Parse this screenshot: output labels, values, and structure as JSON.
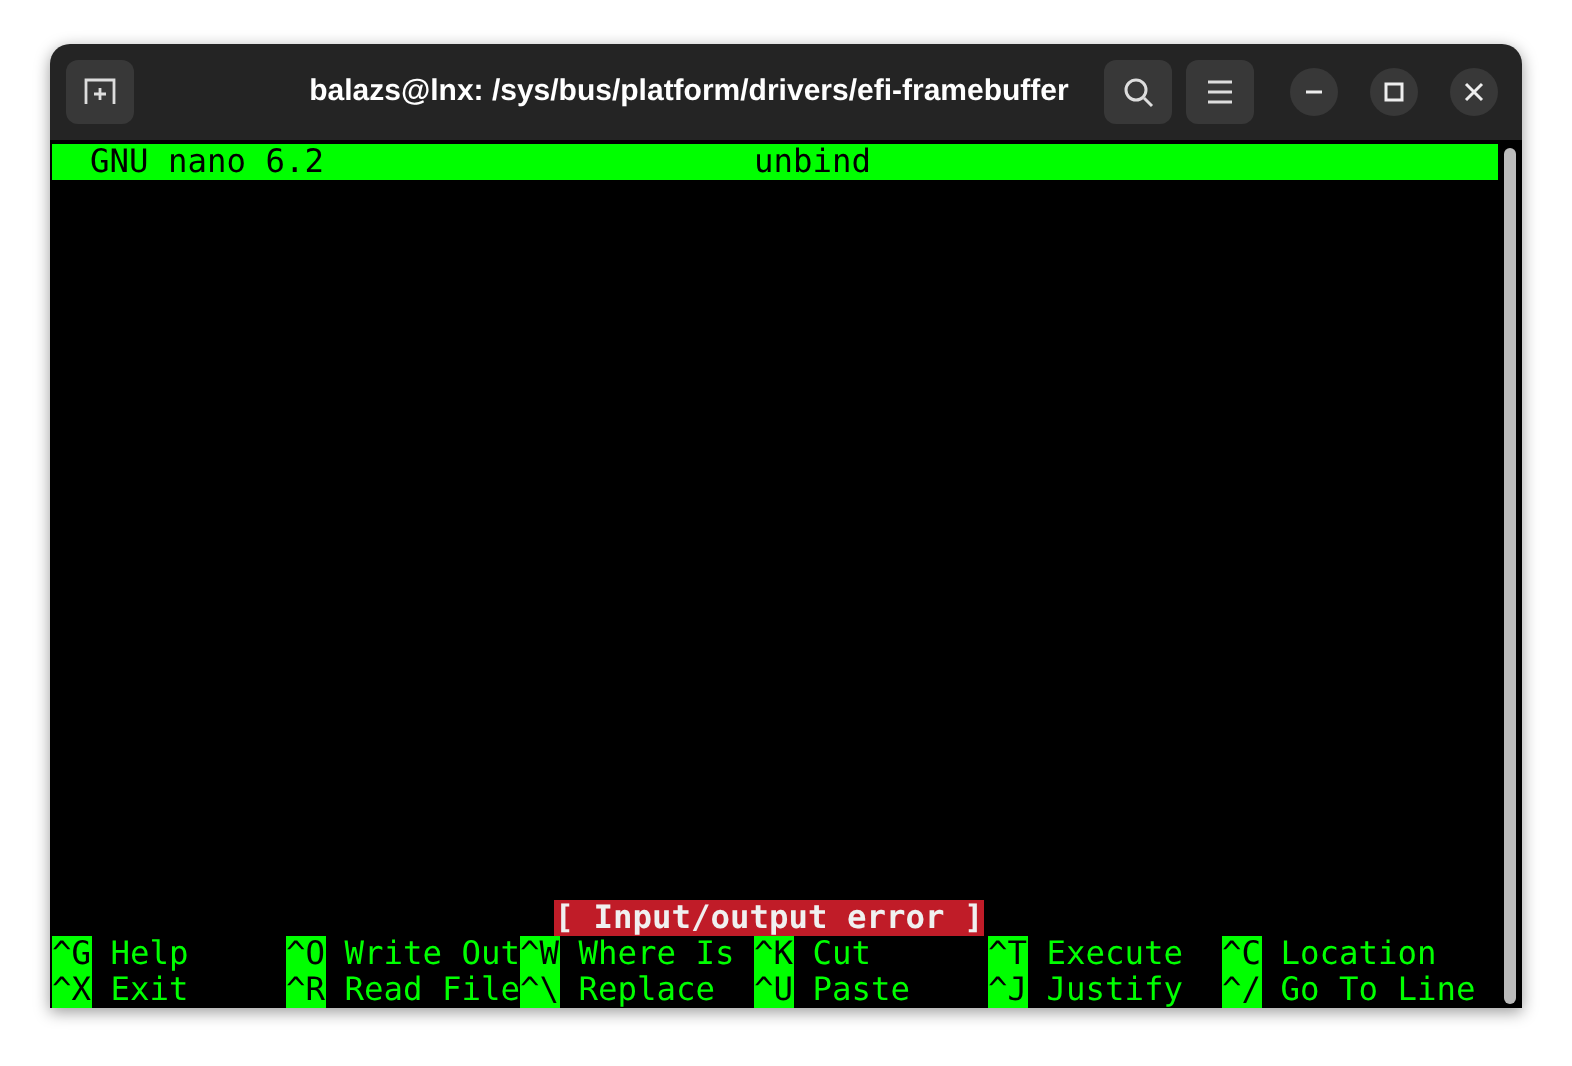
{
  "window": {
    "title": "balazs@lnx: /sys/bus/platform/drivers/efi-framebuffer"
  },
  "nano": {
    "version": "GNU nano 6.2",
    "filename": "unbind",
    "status_message": "[ Input/output error ]"
  },
  "shortcuts": [
    [
      {
        "key": "^G",
        "label": "Help"
      },
      {
        "key": "^O",
        "label": "Write Out"
      },
      {
        "key": "^W",
        "label": "Where Is"
      },
      {
        "key": "^K",
        "label": "Cut"
      },
      {
        "key": "^T",
        "label": "Execute"
      },
      {
        "key": "^C",
        "label": "Location"
      }
    ],
    [
      {
        "key": "^X",
        "label": "Exit"
      },
      {
        "key": "^R",
        "label": "Read File"
      },
      {
        "key": "^\\",
        "label": "Replace"
      },
      {
        "key": "^U",
        "label": "Paste"
      },
      {
        "key": "^J",
        "label": "Justify"
      },
      {
        "key": "^/",
        "label": "Go To Line"
      }
    ]
  ]
}
